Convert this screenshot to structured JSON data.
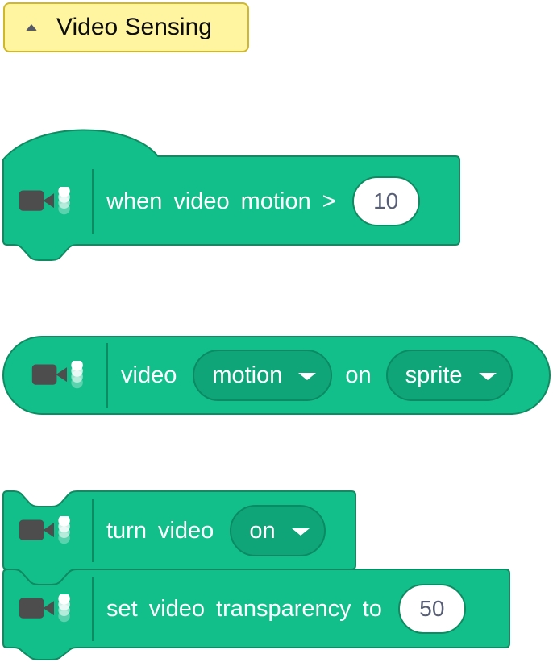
{
  "category": {
    "label": "Video Sensing"
  },
  "colors": {
    "block_fill": "#12bf8a",
    "block_stroke": "#0f8a61",
    "dropdown_fill": "#0fa578",
    "label_bg": "#fff4a0",
    "label_border": "#cfb72e",
    "icon_dark": "#4d4d4d"
  },
  "blocks": {
    "when_motion": {
      "words": [
        "when",
        "video",
        "motion",
        ">"
      ],
      "input_value": "10"
    },
    "video_on": {
      "word_video": "video",
      "dropdown1": "motion",
      "word_on": "on",
      "dropdown2": "sprite"
    },
    "turn_video": {
      "words": [
        "turn",
        "video"
      ],
      "dropdown": "on"
    },
    "set_transparency": {
      "words": [
        "set",
        "video",
        "transparency",
        "to"
      ],
      "input_value": "50"
    }
  },
  "icons": {
    "camera": "video-camera-icon",
    "dots": "stacked-dots-icon",
    "collapse": "collapse-arrow-icon",
    "dropdown": "dropdown-arrow-icon"
  }
}
